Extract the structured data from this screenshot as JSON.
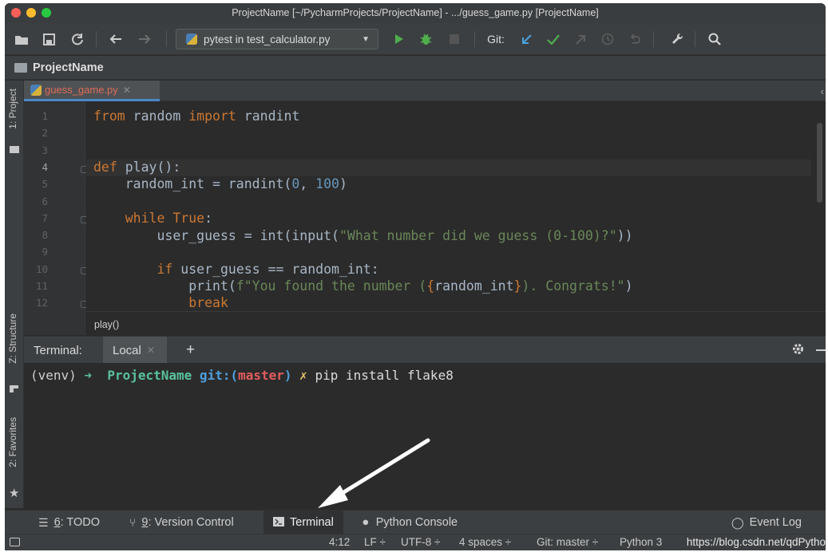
{
  "window": {
    "title": "ProjectName [~/PycharmProjects/ProjectName] - .../guess_game.py [ProjectName]"
  },
  "toolbar": {
    "run_config": "pytest in test_calculator.py",
    "git_label": "Git:"
  },
  "project": {
    "name": "ProjectName"
  },
  "left_tools": {
    "project": "1: Project",
    "structure": "Z: Structure",
    "favorites": "2: Favorites"
  },
  "editor": {
    "tab": "guess_game.py",
    "line_numbers": [
      "1",
      "2",
      "3",
      "4",
      "5",
      "6",
      "7",
      "8",
      "9",
      "10",
      "11",
      "12"
    ],
    "breadcrumb": "play()",
    "lines": {
      "l1_a": "from",
      "l1_b": " random ",
      "l1_c": "import",
      "l1_d": " randint",
      "l4_a": "def",
      "l4_b": " play():",
      "l5_a": "    random_int = randint(",
      "l5_b": "0",
      "l5_c": ", ",
      "l5_d": "100",
      "l5_e": ")",
      "l7_a": "    ",
      "l7_b": "while",
      "l7_c": " ",
      "l7_d": "True",
      "l7_e": ":",
      "l8_a": "        user_guess = int(input(",
      "l8_b": "\"What number did we guess (0-100)?\"",
      "l8_c": "))",
      "l10_a": "        ",
      "l10_b": "if",
      "l10_c": " user_guess == random_int:",
      "l11_a": "            print(",
      "l11_b": "f\"You found the number (",
      "l11_c": "{",
      "l11_d": "random_int",
      "l11_e": "}",
      "l11_f": "). Congrats!\"",
      "l11_g": ")",
      "l12_a": "            ",
      "l12_b": "break"
    }
  },
  "terminal": {
    "label": "Terminal:",
    "tab": "Local",
    "add": "+",
    "prompt": {
      "venv": "(venv)",
      "arrow": " ➜  ",
      "dir": "ProjectName",
      "git": " git:(",
      "branch": "master",
      "git_close": ")",
      "x": " ✗ ",
      "cmd": "pip install flake8"
    }
  },
  "tool_windows": {
    "todo_num": "6",
    "todo": ": TODO",
    "vcs_num": "9",
    "vcs": ": Version Control",
    "terminal": "Terminal",
    "python_console": "Python Console",
    "event_log": "Event Log"
  },
  "status": {
    "position": "4:12",
    "line_sep": "LF ÷",
    "encoding": "UTF-8 ÷",
    "indent": "4 spaces ÷",
    "git": "Git: master ÷",
    "interpreter": "Python 3",
    "watermark": "https://blog.csdn.net/qdPytho"
  },
  "colors": {
    "keyword": "#cc7832",
    "string": "#6a8759",
    "number": "#6897bb",
    "identifier": "#a9b7c6",
    "terminal_green": "#59c29b",
    "terminal_blue": "#4f9fdc",
    "terminal_red": "#e35d5d"
  }
}
